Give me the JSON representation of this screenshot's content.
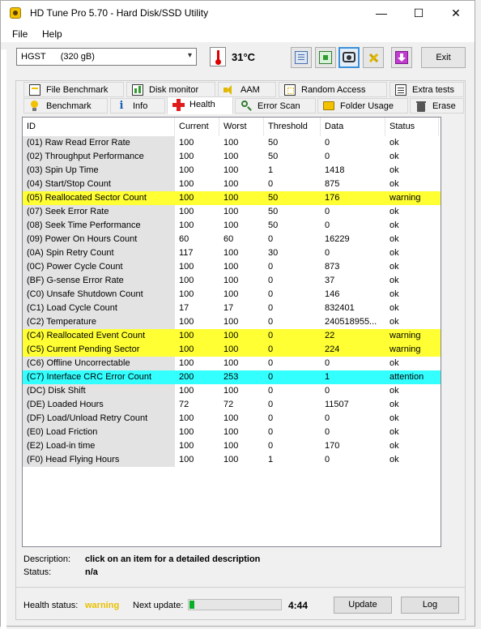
{
  "window": {
    "title": "HD Tune Pro 5.70 - Hard Disk/SSD Utility",
    "minimize": "—",
    "maximize": "☐",
    "close": "✕"
  },
  "menu": {
    "file": "File",
    "help": "Help"
  },
  "toolbar": {
    "drive": "HGST      (320 gB)",
    "temperature": "31°C",
    "exit": "Exit"
  },
  "tabs_row1": [
    "File Benchmark",
    "Disk monitor",
    "AAM",
    "Random Access",
    "Extra tests"
  ],
  "tabs_row2": [
    "Benchmark",
    "Info",
    "Health",
    "Error Scan",
    "Folder Usage",
    "Erase"
  ],
  "active_tab": "Health",
  "table": {
    "headers": [
      "ID",
      "Current",
      "Worst",
      "Threshold",
      "Data",
      "Status"
    ],
    "rows": [
      {
        "id": "(01) Raw Read Error Rate",
        "current": "100",
        "worst": "100",
        "threshold": "50",
        "data": "0",
        "status": "ok",
        "highlight": ""
      },
      {
        "id": "(02) Throughput Performance",
        "current": "100",
        "worst": "100",
        "threshold": "50",
        "data": "0",
        "status": "ok",
        "highlight": ""
      },
      {
        "id": "(03) Spin Up Time",
        "current": "100",
        "worst": "100",
        "threshold": "1",
        "data": "1418",
        "status": "ok",
        "highlight": ""
      },
      {
        "id": "(04) Start/Stop Count",
        "current": "100",
        "worst": "100",
        "threshold": "0",
        "data": "875",
        "status": "ok",
        "highlight": ""
      },
      {
        "id": "(05) Reallocated Sector Count",
        "current": "100",
        "worst": "100",
        "threshold": "50",
        "data": "176",
        "status": "warning",
        "highlight": "warning"
      },
      {
        "id": "(07) Seek Error Rate",
        "current": "100",
        "worst": "100",
        "threshold": "50",
        "data": "0",
        "status": "ok",
        "highlight": ""
      },
      {
        "id": "(08) Seek Time Performance",
        "current": "100",
        "worst": "100",
        "threshold": "50",
        "data": "0",
        "status": "ok",
        "highlight": ""
      },
      {
        "id": "(09) Power On Hours Count",
        "current": "60",
        "worst": "60",
        "threshold": "0",
        "data": "16229",
        "status": "ok",
        "highlight": ""
      },
      {
        "id": "(0A) Spin Retry Count",
        "current": "117",
        "worst": "100",
        "threshold": "30",
        "data": "0",
        "status": "ok",
        "highlight": ""
      },
      {
        "id": "(0C) Power Cycle Count",
        "current": "100",
        "worst": "100",
        "threshold": "0",
        "data": "873",
        "status": "ok",
        "highlight": ""
      },
      {
        "id": "(BF) G-sense Error Rate",
        "current": "100",
        "worst": "100",
        "threshold": "0",
        "data": "37",
        "status": "ok",
        "highlight": ""
      },
      {
        "id": "(C0) Unsafe Shutdown Count",
        "current": "100",
        "worst": "100",
        "threshold": "0",
        "data": "146",
        "status": "ok",
        "highlight": ""
      },
      {
        "id": "(C1) Load Cycle Count",
        "current": "17",
        "worst": "17",
        "threshold": "0",
        "data": "832401",
        "status": "ok",
        "highlight": ""
      },
      {
        "id": "(C2) Temperature",
        "current": "100",
        "worst": "100",
        "threshold": "0",
        "data": "240518955...",
        "status": "ok",
        "highlight": ""
      },
      {
        "id": "(C4) Reallocated Event Count",
        "current": "100",
        "worst": "100",
        "threshold": "0",
        "data": "22",
        "status": "warning",
        "highlight": "warning"
      },
      {
        "id": "(C5) Current Pending Sector",
        "current": "100",
        "worst": "100",
        "threshold": "0",
        "data": "224",
        "status": "warning",
        "highlight": "warning"
      },
      {
        "id": "(C6) Offline Uncorrectable",
        "current": "100",
        "worst": "100",
        "threshold": "0",
        "data": "0",
        "status": "ok",
        "highlight": ""
      },
      {
        "id": "(C7) Interface CRC Error Count",
        "current": "200",
        "worst": "253",
        "threshold": "0",
        "data": "1",
        "status": "attention",
        "highlight": "attention"
      },
      {
        "id": "(DC) Disk Shift",
        "current": "100",
        "worst": "100",
        "threshold": "0",
        "data": "0",
        "status": "ok",
        "highlight": ""
      },
      {
        "id": "(DE) Loaded Hours",
        "current": "72",
        "worst": "72",
        "threshold": "0",
        "data": "11507",
        "status": "ok",
        "highlight": ""
      },
      {
        "id": "(DF) Load/Unload Retry Count",
        "current": "100",
        "worst": "100",
        "threshold": "0",
        "data": "0",
        "status": "ok",
        "highlight": ""
      },
      {
        "id": "(E0) Load Friction",
        "current": "100",
        "worst": "100",
        "threshold": "0",
        "data": "0",
        "status": "ok",
        "highlight": ""
      },
      {
        "id": "(E2) Load-in time",
        "current": "100",
        "worst": "100",
        "threshold": "0",
        "data": "170",
        "status": "ok",
        "highlight": ""
      },
      {
        "id": "(F0) Head Flying Hours",
        "current": "100",
        "worst": "100",
        "threshold": "1",
        "data": "0",
        "status": "ok",
        "highlight": ""
      }
    ]
  },
  "details": {
    "description_label": "Description:",
    "description_value": "click on an item for a detailed description",
    "status_label": "Status:",
    "status_value": "n/a"
  },
  "footer": {
    "health_label": "Health status:",
    "health_value": "warning",
    "next_update_label": "Next update:",
    "progress_fraction": 0.05,
    "countdown": "4:44",
    "update_button": "Update",
    "log_button": "Log"
  },
  "colors": {
    "warning_row": "#ffff33",
    "attention_row": "#33ffff",
    "health_warning_text": "#e8c000",
    "progress_fill": "#06b025"
  }
}
